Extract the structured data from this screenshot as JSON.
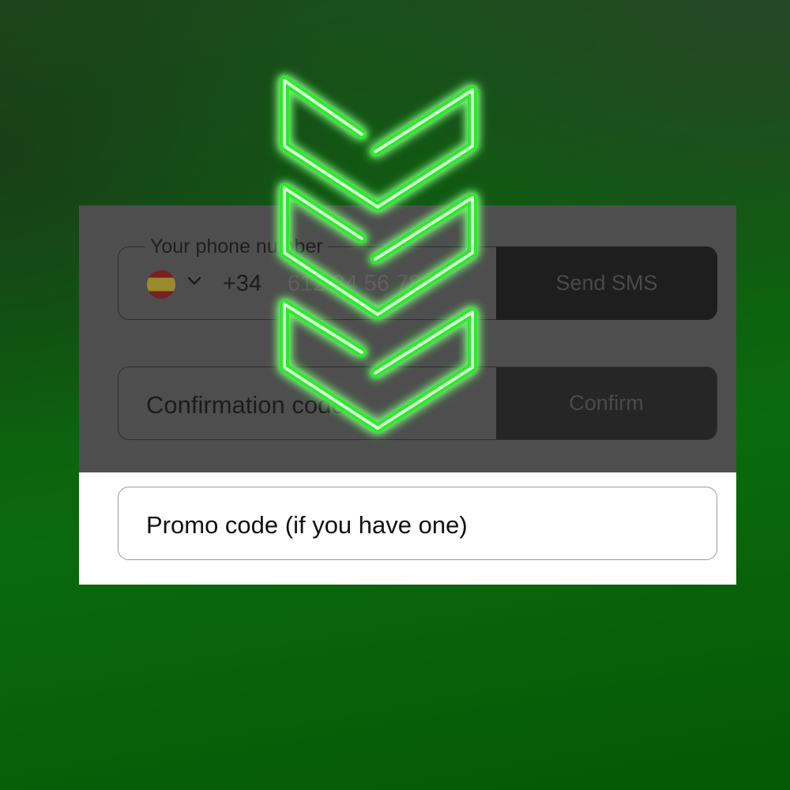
{
  "form": {
    "phone": {
      "label": "Your phone number",
      "country_flag": "flag-spain-icon",
      "prefix": "+34",
      "placeholder": "612 34 56 78",
      "send_button": "Send SMS"
    },
    "confirmation": {
      "placeholder": "Confirmation code",
      "confirm_button": "Confirm"
    },
    "promo": {
      "placeholder": "Promo code (if you have one)"
    }
  },
  "overlay": {
    "icon": "neon-triple-chevron-down-icon",
    "glow_color": "#3cff3c"
  },
  "colors": {
    "background": "#0b6a0d",
    "dark_panel": "#4e4e4e",
    "light_panel": "#ffffff"
  }
}
